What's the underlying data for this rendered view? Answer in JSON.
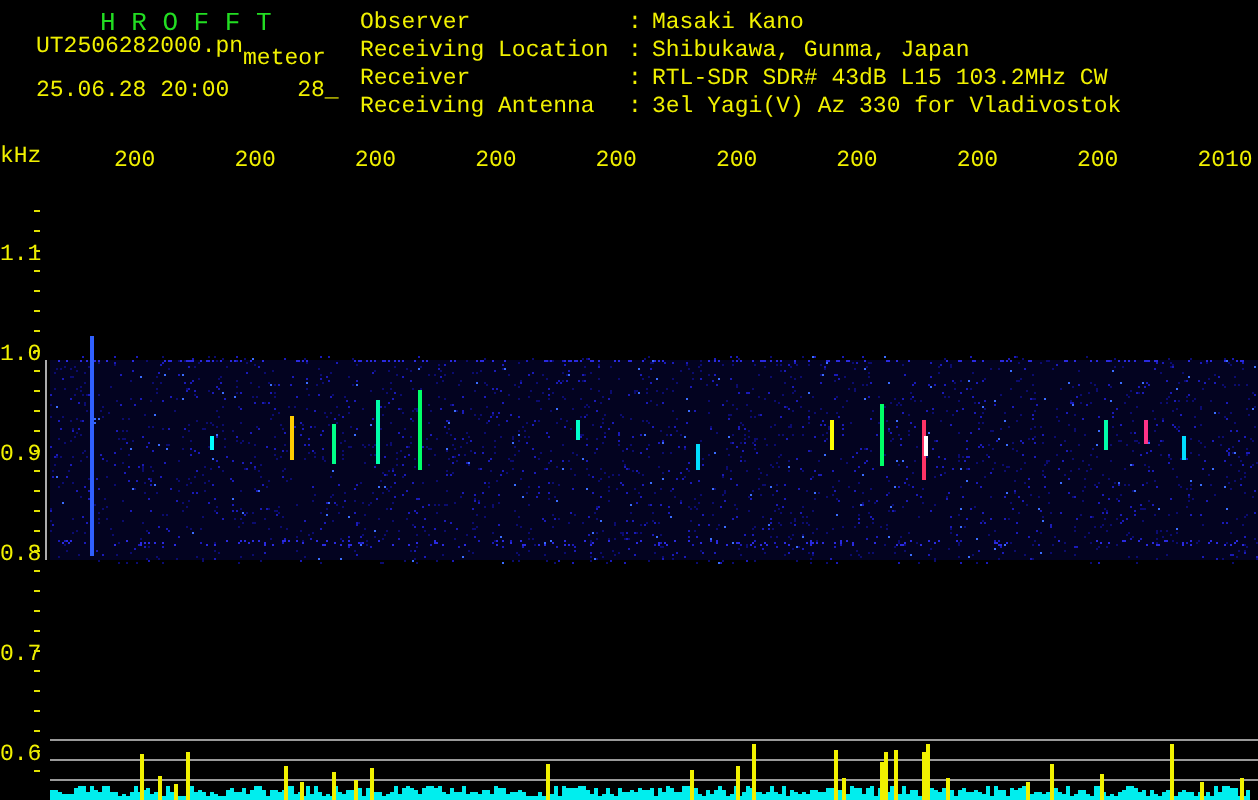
{
  "header": {
    "title": "H R O F F T",
    "filename": "UT2506282000.pn",
    "tag": "meteor",
    "timestamp": "25.06.28 20:00",
    "count": "28_"
  },
  "info": [
    {
      "label": "Observer",
      "separator": ":",
      "value": "Masaki Kano"
    },
    {
      "label": "Receiving Location",
      "separator": ":",
      "value": "Shibukawa, Gunma, Japan"
    },
    {
      "label": "Receiver",
      "separator": ":",
      "value": "RTL-SDR SDR# 43dB L15 103.2MHz CW"
    },
    {
      "label": "Receiving Antenna",
      "separator": ":",
      "value": "3el Yagi(V) Az 330 for Vladivostok"
    }
  ],
  "time_axis": {
    "labels": [
      "200",
      "200",
      "200",
      "200",
      "200",
      "200",
      "200",
      "200",
      "200",
      "2010"
    ]
  },
  "freq_axis": {
    "unit": "kHz",
    "labels": [
      "1.1",
      "1.0",
      "0.9",
      "0.8",
      "0.7",
      "0.6"
    ]
  }
}
